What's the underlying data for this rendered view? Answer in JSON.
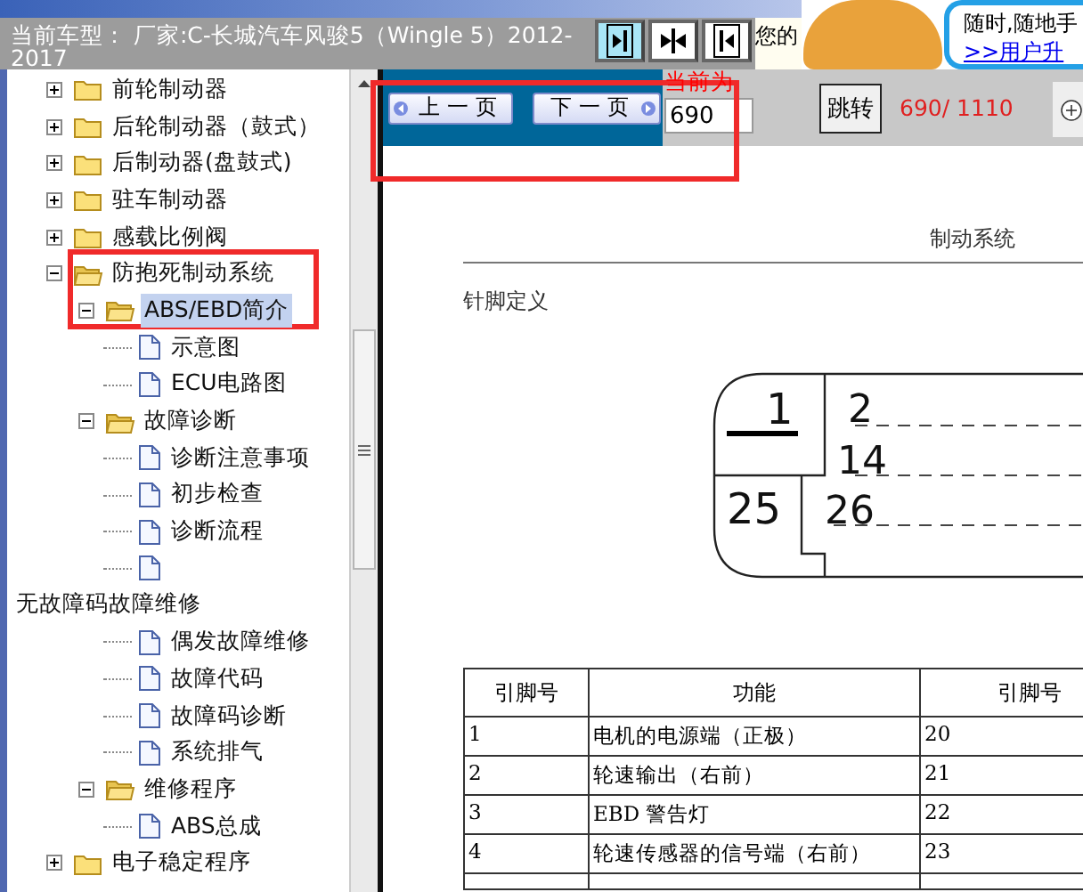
{
  "header": {
    "car_label": "当前车型： 厂家:C-长城汽车风骏5（Wingle 5）2012-2017",
    "nav_buttons": [
      {
        "kind": "right",
        "selected": true
      },
      {
        "kind": "both",
        "selected": false
      },
      {
        "kind": "left",
        "selected": false
      }
    ],
    "notice": "您的",
    "ad": {
      "line": "随时,随地手",
      "link": ">>用户升"
    }
  },
  "tree": {
    "items": [
      {
        "kind": "folder",
        "label": "前轮制动器",
        "expanded": false,
        "selected": false,
        "highlighted": false
      },
      {
        "kind": "folder",
        "label": "后轮制动器（鼓式）",
        "expanded": false,
        "selected": false,
        "highlighted": false
      },
      {
        "kind": "folder",
        "label": "后制动器(盘鼓式)",
        "expanded": false,
        "selected": false,
        "highlighted": false
      },
      {
        "kind": "folder",
        "label": "驻车制动器",
        "expanded": false,
        "selected": false,
        "highlighted": false
      },
      {
        "kind": "folder",
        "label": "感载比例阀",
        "expanded": false,
        "selected": false,
        "highlighted": false
      },
      {
        "kind": "folder",
        "label": "防抱死制动系统",
        "expanded": true,
        "selected": false,
        "highlighted": true,
        "children": [
          {
            "kind": "folder",
            "label": "ABS/EBD简介",
            "expanded": true,
            "selected": true,
            "highlighted": false,
            "children": [
              {
                "kind": "doc",
                "label": "示意图",
                "selected": false,
                "highlighted": false
              },
              {
                "kind": "doc",
                "label": "ECU电路图",
                "selected": false,
                "highlighted": false
              }
            ]
          },
          {
            "kind": "folder",
            "label": "故障诊断",
            "expanded": true,
            "selected": false,
            "highlighted": false,
            "children": [
              {
                "kind": "doc",
                "label": "诊断注意事项",
                "selected": false,
                "highlighted": false
              },
              {
                "kind": "doc",
                "label": "初步检查",
                "selected": false,
                "highlighted": false
              },
              {
                "kind": "doc",
                "label": "诊断流程",
                "selected": false,
                "highlighted": false
              },
              {
                "kind": "doc-wrapped",
                "label": "无故障码故障维修",
                "selected": false,
                "highlighted": false
              },
              {
                "kind": "doc",
                "label": "偶发故障维修",
                "selected": false,
                "highlighted": false
              },
              {
                "kind": "doc",
                "label": "故障代码",
                "selected": false,
                "highlighted": false
              },
              {
                "kind": "doc",
                "label": "故障码诊断",
                "selected": false,
                "highlighted": false
              },
              {
                "kind": "doc",
                "label": "系统排气",
                "selected": false,
                "highlighted": false
              }
            ]
          },
          {
            "kind": "folder",
            "label": "维修程序",
            "expanded": true,
            "selected": false,
            "highlighted": false,
            "children": [
              {
                "kind": "doc",
                "label": "ABS总成",
                "selected": false,
                "highlighted": false
              }
            ]
          }
        ]
      },
      {
        "kind": "folder",
        "label": "电子稳定程序",
        "expanded": false,
        "selected": false,
        "highlighted": false
      }
    ]
  },
  "toolbar": {
    "highlighted": true,
    "prev_button": "上 一 页",
    "next_button": "下 一 页",
    "current_label": "当前为",
    "page_input": {
      "value": "690"
    },
    "jump_button": "跳转",
    "page_count": "690/ 1110"
  },
  "document": {
    "header": "制动系统",
    "section_title": "针脚定义",
    "connector_pins": [
      "1",
      "2",
      "14",
      "25",
      "26"
    ],
    "pin_table": {
      "columns": [
        "引脚号",
        "功能",
        "引脚号"
      ],
      "rows": [
        [
          "1",
          "电机的电源端（正极）",
          "20"
        ],
        [
          "2",
          "轮速输出（右前）",
          "21"
        ],
        [
          "3",
          "EBD 警告灯",
          "22"
        ],
        [
          "4",
          "轮速传感器的信号端（右前）",
          "23"
        ]
      ]
    }
  }
}
